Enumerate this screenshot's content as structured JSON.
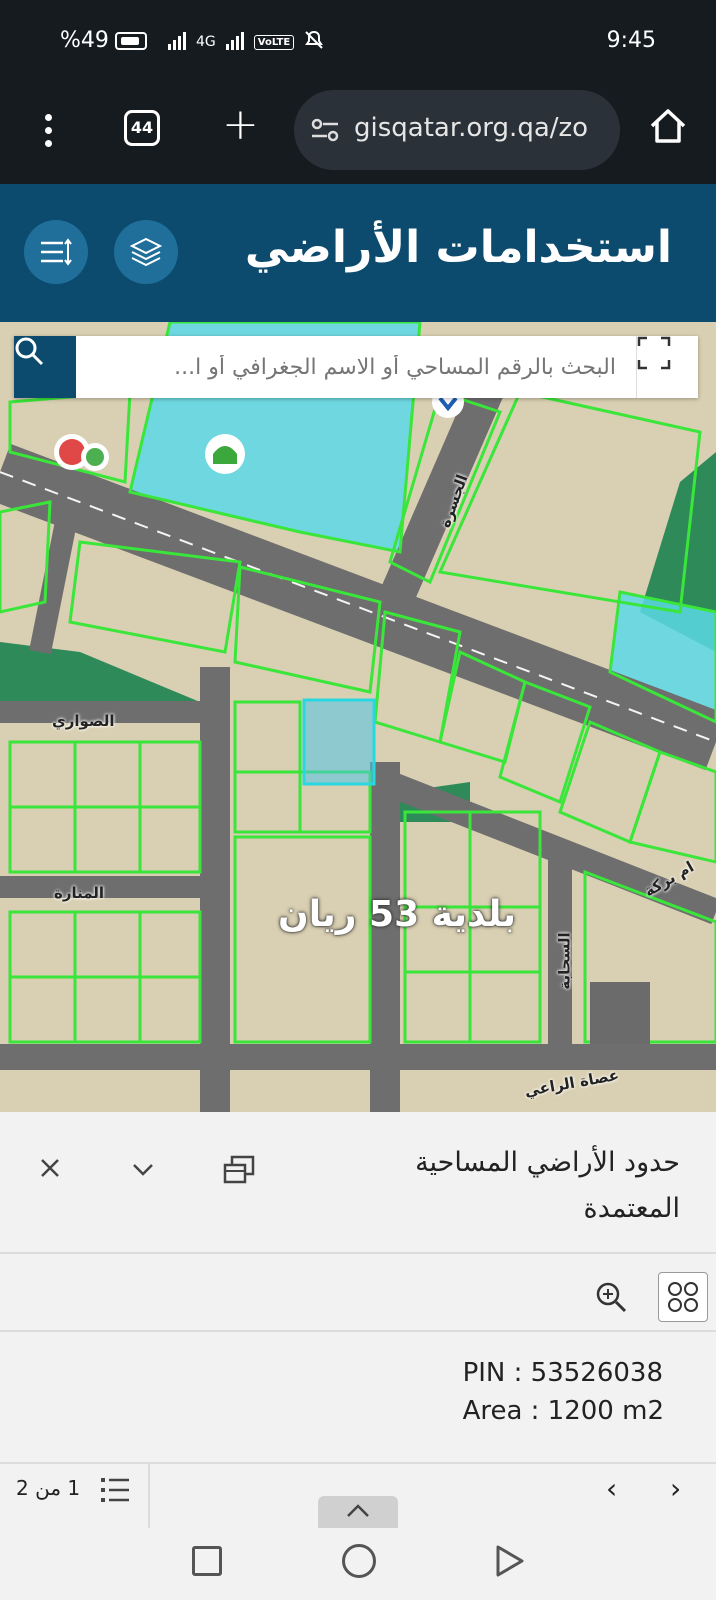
{
  "status_bar": {
    "time": "9:45",
    "battery": "%49",
    "network": "4G",
    "volte": "VoLTE"
  },
  "browser": {
    "tab_count": "44",
    "url": "gisqatar.org.qa/zo"
  },
  "header": {
    "title": "استخدامات الأراضي"
  },
  "search": {
    "placeholder": "البحث بالرقم المساحي أو الاسم الجغرافي أو ا..."
  },
  "map": {
    "street_labels": [
      "الصواري",
      "المنارة",
      "الجسرة",
      "السحابة",
      "ام بركة",
      "عصاة الراعي"
    ],
    "district_label": "بلدية 53 ريان",
    "colors": {
      "parcel_outline": "#39e639",
      "highlight": "#29d7e0",
      "government": "#5ad8e6",
      "green_area": "#2f8a5a",
      "road": "#6e6e6e"
    }
  },
  "panel": {
    "title": "حدود الأراضي المساحية المعتمدة",
    "pin": "PIN : 53526038",
    "area": "Area : 1200 m2",
    "pager_count": "1 من 2"
  }
}
